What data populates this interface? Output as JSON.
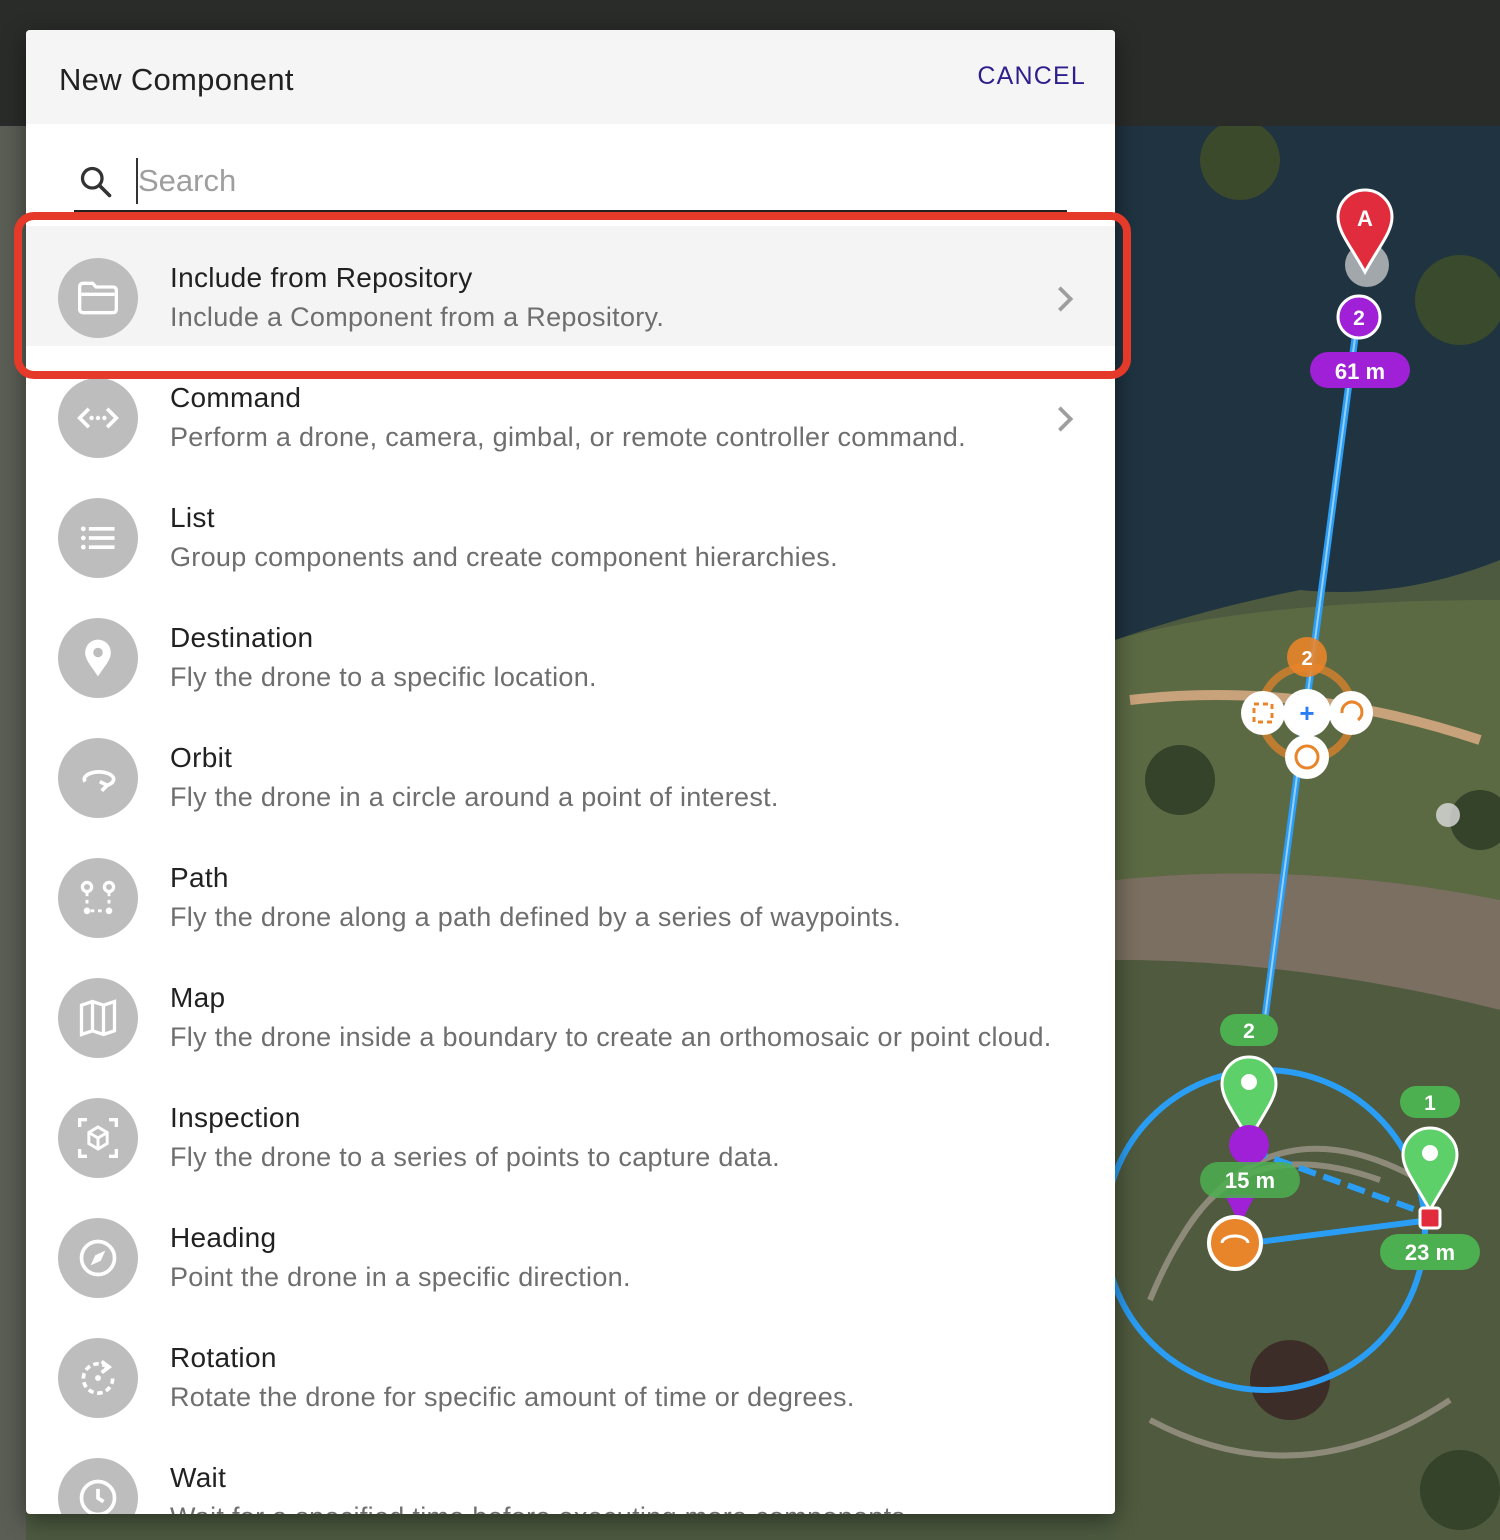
{
  "dialog": {
    "title": "New Component",
    "cancel_label": "CANCEL",
    "search": {
      "placeholder": "Search",
      "value": ""
    }
  },
  "components": [
    {
      "title": "Include from Repository",
      "description": "Include a Component from a Repository.",
      "icon": "folder-icon",
      "has_chevron": true,
      "highlighted": true
    },
    {
      "title": "Command",
      "description": "Perform a drone, camera, gimbal, or remote controller command.",
      "icon": "code-arrows-icon",
      "has_chevron": true
    },
    {
      "title": "List",
      "description": "Group components and create component hierarchies.",
      "icon": "list-icon",
      "has_chevron": false
    },
    {
      "title": "Destination",
      "description": "Fly the drone to a specific location.",
      "icon": "location-pin-icon",
      "has_chevron": false
    },
    {
      "title": "Orbit",
      "description": "Fly the drone in a circle around a point of interest.",
      "icon": "orbit-icon",
      "has_chevron": false
    },
    {
      "title": "Path",
      "description": "Fly the drone along a path defined by a series of waypoints.",
      "icon": "path-icon",
      "has_chevron": false
    },
    {
      "title": "Map",
      "description": "Fly the drone inside a boundary to create an orthomosaic or point cloud.",
      "icon": "map-icon",
      "has_chevron": false
    },
    {
      "title": "Inspection",
      "description": "Fly the drone to a series of points to capture data.",
      "icon": "inspection-cube-icon",
      "has_chevron": false
    },
    {
      "title": "Heading",
      "description": "Point the drone in a specific direction.",
      "icon": "compass-icon",
      "has_chevron": false
    },
    {
      "title": "Rotation",
      "description": "Rotate the drone for specific amount of time or degrees.",
      "icon": "rotation-icon",
      "has_chevron": false
    },
    {
      "title": "Wait",
      "description": "Wait for a specified time before executing more components.",
      "icon": "clock-icon",
      "has_chevron": false
    }
  ],
  "map_overlay": {
    "marker_a_label": "A",
    "purple_badge": "2",
    "distance_1": "61 m",
    "orange_badge": "2",
    "green_badge_left": "2",
    "green_badge_right": "1",
    "distance_2": "15 m",
    "distance_3": "23 m"
  },
  "colors": {
    "accent": "#2e1f8c",
    "highlight_border": "#e53a2a",
    "icon_circle": "#bdbdbd",
    "route_line": "#2a9df4",
    "purple": "#a020d8",
    "green": "#4caf50",
    "orange": "#e8842a",
    "red_marker": "#e02c3c"
  }
}
